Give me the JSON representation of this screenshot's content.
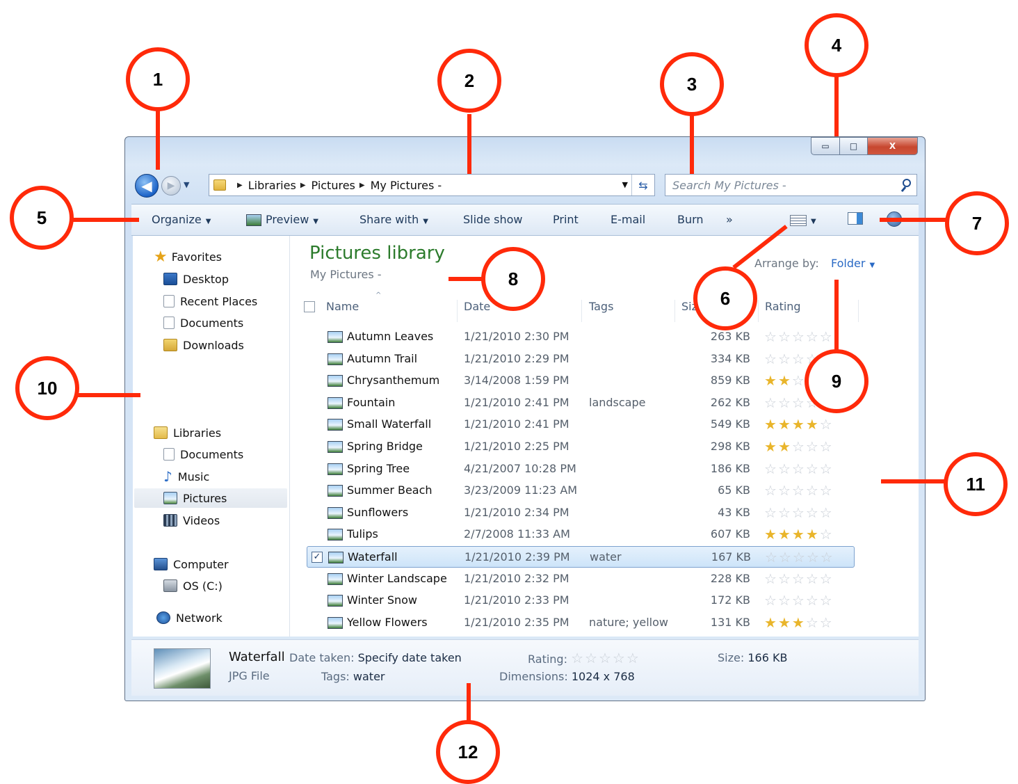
{
  "window": {
    "caption": {
      "minimize": "▭",
      "maximize": "□",
      "close": "X"
    },
    "nav": {
      "back_icon": "◀",
      "forward_icon": "▶",
      "recent_icon": "▼"
    },
    "address": {
      "crumbs": [
        "Libraries",
        "Pictures",
        "My Pictures -"
      ],
      "dropdown": "▼",
      "refresh_icon": "⇆"
    },
    "search": {
      "placeholder": "Search My Pictures -"
    },
    "toolbar": {
      "organize": "Organize",
      "preview": "Preview",
      "share_with": "Share with",
      "slide_show": "Slide show",
      "print": "Print",
      "email": "E-mail",
      "burn": "Burn",
      "more": "»"
    },
    "navpane": {
      "favorites": "Favorites",
      "desktop": "Desktop",
      "recent_places": "Recent Places",
      "documents": "Documents",
      "downloads": "Downloads",
      "libraries": "Libraries",
      "lib_documents": "Documents",
      "music": "Music",
      "pictures": "Pictures",
      "videos": "Videos",
      "computer": "Computer",
      "os": "OS (C:)",
      "network": "Network"
    },
    "library": {
      "title": "Pictures library",
      "subtitle": "My Pictures -",
      "arrange_label": "Arrange by:",
      "arrange_value": "Folder"
    },
    "columns": {
      "name": "Name",
      "date": "Date",
      "tags": "Tags",
      "size": "Size",
      "rating": "Rating"
    },
    "files": [
      {
        "name": "Autumn Leaves",
        "date": "1/21/2010 2:30 PM",
        "tags": "",
        "size": "263 KB",
        "rating": 0
      },
      {
        "name": "Autumn Trail",
        "date": "1/21/2010 2:29 PM",
        "tags": "",
        "size": "334 KB",
        "rating": 0
      },
      {
        "name": "Chrysanthemum",
        "date": "3/14/2008 1:59 PM",
        "tags": "",
        "size": "859 KB",
        "rating": 2
      },
      {
        "name": "Fountain",
        "date": "1/21/2010 2:41 PM",
        "tags": "landscape",
        "size": "262 KB",
        "rating": 0
      },
      {
        "name": "Small Waterfall",
        "date": "1/21/2010 2:41 PM",
        "tags": "",
        "size": "549 KB",
        "rating": 4
      },
      {
        "name": "Spring Bridge",
        "date": "1/21/2010 2:25 PM",
        "tags": "",
        "size": "298 KB",
        "rating": 2
      },
      {
        "name": "Spring Tree",
        "date": "4/21/2007 10:28 PM",
        "tags": "",
        "size": "186 KB",
        "rating": 0
      },
      {
        "name": "Summer Beach",
        "date": "3/23/2009 11:23 AM",
        "tags": "",
        "size": "65 KB",
        "rating": 0
      },
      {
        "name": "Sunflowers",
        "date": "1/21/2010 2:34 PM",
        "tags": "",
        "size": "43 KB",
        "rating": 0
      },
      {
        "name": "Tulips",
        "date": "2/7/2008 11:33 AM",
        "tags": "",
        "size": "607 KB",
        "rating": 4
      },
      {
        "name": "Waterfall",
        "date": "1/21/2010 2:39 PM",
        "tags": "water",
        "size": "167 KB",
        "rating": 0,
        "selected": true
      },
      {
        "name": "Winter Landscape",
        "date": "1/21/2010 2:32 PM",
        "tags": "",
        "size": "228 KB",
        "rating": 0
      },
      {
        "name": "Winter Snow",
        "date": "1/21/2010 2:33 PM",
        "tags": "",
        "size": "172 KB",
        "rating": 0
      },
      {
        "name": "Yellow Flowers",
        "date": "1/21/2010 2:35 PM",
        "tags": "nature; yellow",
        "size": "131 KB",
        "rating": 3
      }
    ],
    "details": {
      "name": "Waterfall",
      "type": "JPG File",
      "date_taken_label": "Date taken:",
      "date_taken_value": "Specify date taken",
      "tags_label": "Tags:",
      "tags_value": "water",
      "rating_label": "Rating:",
      "rating": 0,
      "dimensions_label": "Dimensions:",
      "dimensions_value": "1024 x 768",
      "size_label": "Size:",
      "size_value": "166 KB"
    }
  },
  "callouts": [
    "1",
    "2",
    "3",
    "4",
    "5",
    "6",
    "7",
    "8",
    "9",
    "10",
    "11",
    "12"
  ],
  "colors": {
    "callout": "#ff2a0a",
    "library_title": "#2c7b2c",
    "link": "#2a6ac5",
    "star_on": "#e9b52b"
  }
}
